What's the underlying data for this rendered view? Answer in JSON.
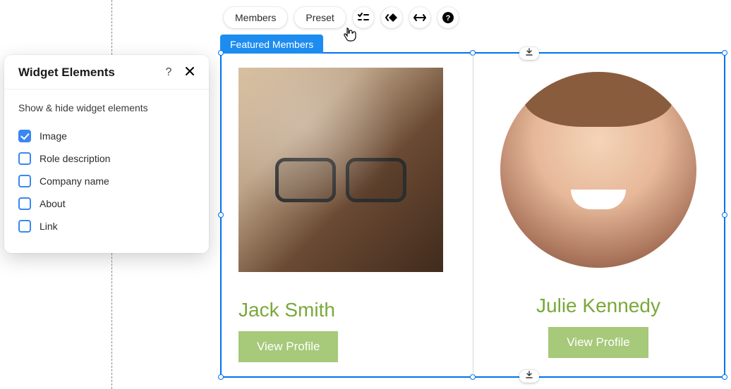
{
  "toolbar": {
    "members_label": "Members",
    "preset_label": "Preset"
  },
  "widget": {
    "tab_label": "Featured Members",
    "members": [
      {
        "name": "Jack Smith",
        "button": "View Profile"
      },
      {
        "name": "Julie Kennedy",
        "button": "View Profile"
      }
    ]
  },
  "panel": {
    "title": "Widget Elements",
    "subtitle": "Show & hide widget elements",
    "items": [
      {
        "label": "Image",
        "checked": true
      },
      {
        "label": "Role description",
        "checked": false
      },
      {
        "label": "Company name",
        "checked": false
      },
      {
        "label": "About",
        "checked": false
      },
      {
        "label": "Link",
        "checked": false
      }
    ]
  }
}
